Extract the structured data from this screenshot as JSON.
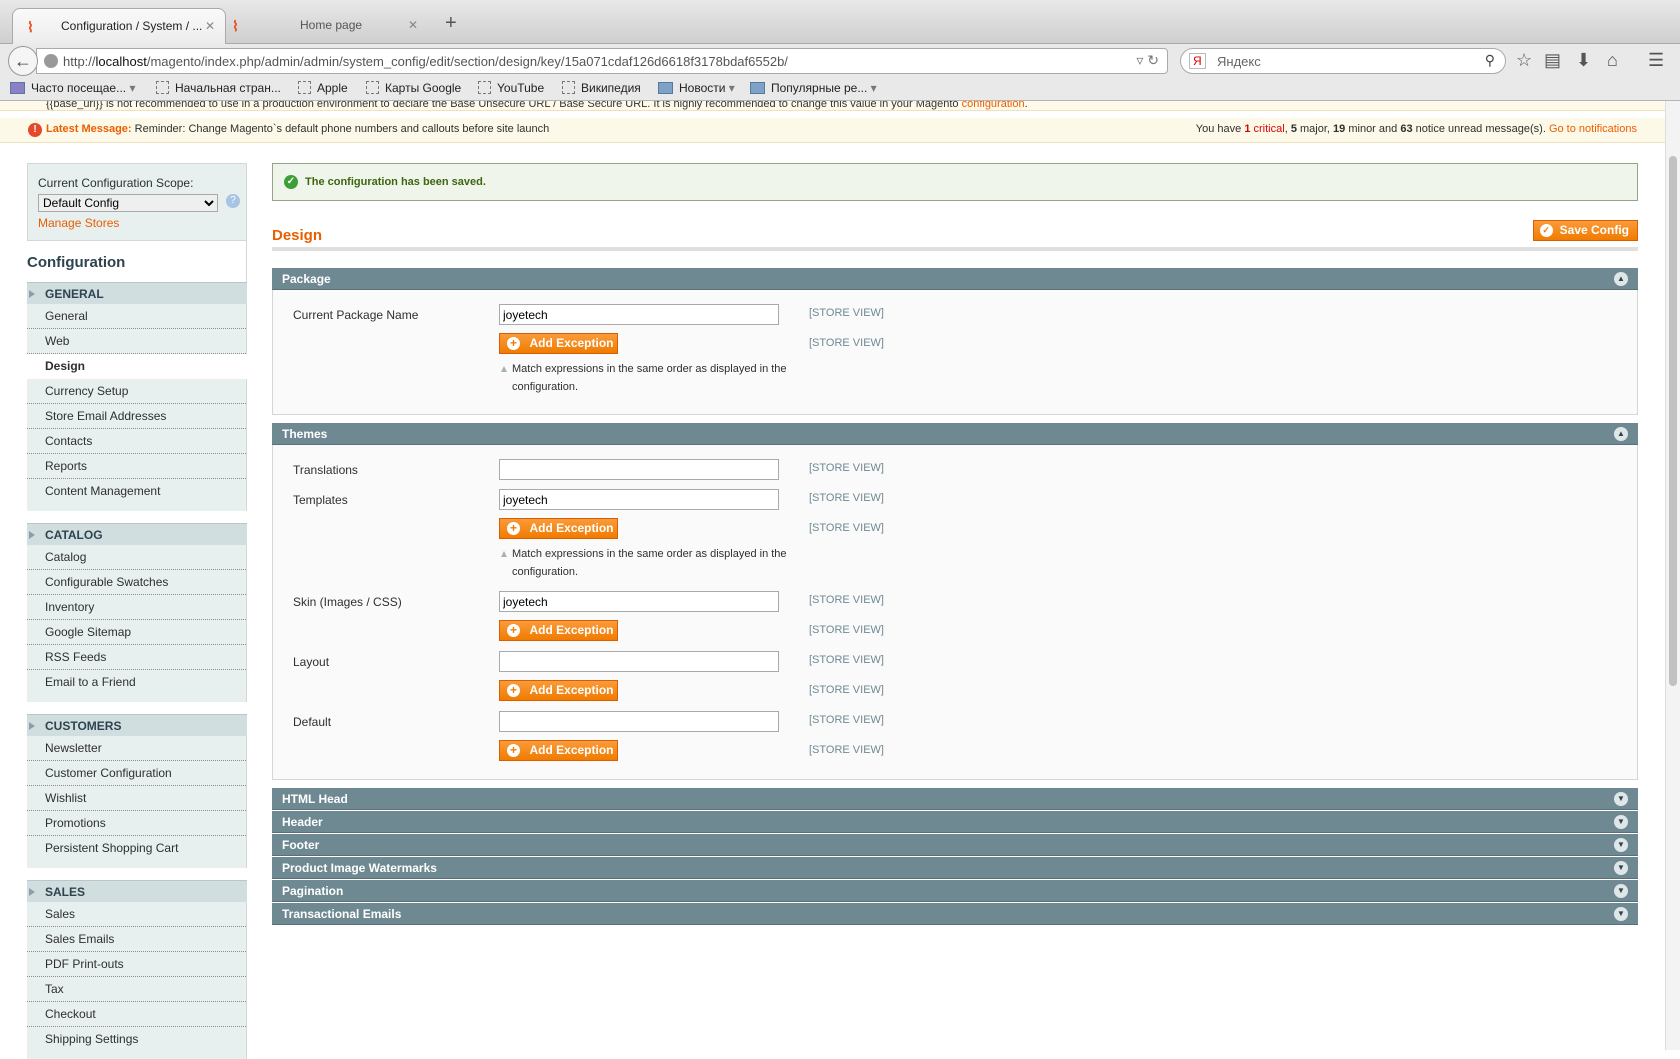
{
  "browser": {
    "tabs": [
      {
        "label": "Configuration / System / ...",
        "active": true
      },
      {
        "label": "Home page",
        "active": false
      }
    ],
    "url_prefix": "http://",
    "url_host": "localhost",
    "url_path": "/magento/index.php/admin/admin/system_config/edit/section/design/key/15a071cdaf126d6618f3178bdaf6552b/",
    "search_engine_badge": "Я",
    "search_placeholder": "Яндекс",
    "bookmarks": [
      "Часто посещае...",
      "Начальная стран...",
      "Apple",
      "Карты Google",
      "YouTube",
      "Википедия",
      "Новости",
      "Популярные ре..."
    ]
  },
  "notices": {
    "warning_text": "{{base_url}} is not recommended to use in a production environment to declare the Base Unsecure URL / Base Secure URL. It is highly recommended to change this value in your Magento",
    "warning_link": "configuration",
    "latest_label": "Latest Message:",
    "latest_text": "Reminder: Change Magento`s default phone numbers and callouts before site launch",
    "summary_prefix": "You have",
    "critical_count": "1",
    "critical_label": "critical",
    "major_count": "5",
    "major_label": "major,",
    "minor_count": "19",
    "minor_label": "minor and",
    "notice_count": "63",
    "notice_label": "notice unread message(s).",
    "go_link": "Go to notifications"
  },
  "sidebar": {
    "scope_label": "Current Configuration Scope:",
    "scope_value": "Default Config",
    "manage_stores": "Manage Stores",
    "title": "Configuration",
    "groups": [
      {
        "label": "GENERAL",
        "items": [
          "General",
          "Web",
          "Design",
          "Currency Setup",
          "Store Email Addresses",
          "Contacts",
          "Reports",
          "Content Management"
        ],
        "active": "Design"
      },
      {
        "label": "CATALOG",
        "items": [
          "Catalog",
          "Configurable Swatches",
          "Inventory",
          "Google Sitemap",
          "RSS Feeds",
          "Email to a Friend"
        ]
      },
      {
        "label": "CUSTOMERS",
        "items": [
          "Newsletter",
          "Customer Configuration",
          "Wishlist",
          "Promotions",
          "Persistent Shopping Cart"
        ]
      },
      {
        "label": "SALES",
        "items": [
          "Sales",
          "Sales Emails",
          "PDF Print-outs",
          "Tax",
          "Checkout",
          "Shipping Settings"
        ]
      }
    ]
  },
  "main": {
    "success_message": "The configuration has been saved.",
    "page_title": "Design",
    "save_button": "Save Config",
    "scope_tag": "[STORE VIEW]",
    "add_exception": "Add Exception",
    "note": "Match expressions in the same order as displayed in the configuration.",
    "package": {
      "title": "Package",
      "current_package_label": "Current Package Name",
      "current_package_value": "joyetech"
    },
    "themes": {
      "title": "Themes",
      "fields": [
        {
          "label": "Translations",
          "value": "",
          "note": false
        },
        {
          "label": "Templates",
          "value": "joyetech",
          "note": true
        },
        {
          "label": "Skin (Images / CSS)",
          "value": "joyetech",
          "note": false
        },
        {
          "label": "Layout",
          "value": "",
          "note": false
        },
        {
          "label": "Default",
          "value": "",
          "note": false
        }
      ]
    },
    "collapsed_sections": [
      "HTML Head",
      "Header",
      "Footer",
      "Product Image Watermarks",
      "Pagination",
      "Transactional Emails"
    ]
  },
  "colors": {
    "accent": "#eb5e00",
    "section_header": "#6f8992",
    "sidebar_bg": "#e7efef"
  }
}
